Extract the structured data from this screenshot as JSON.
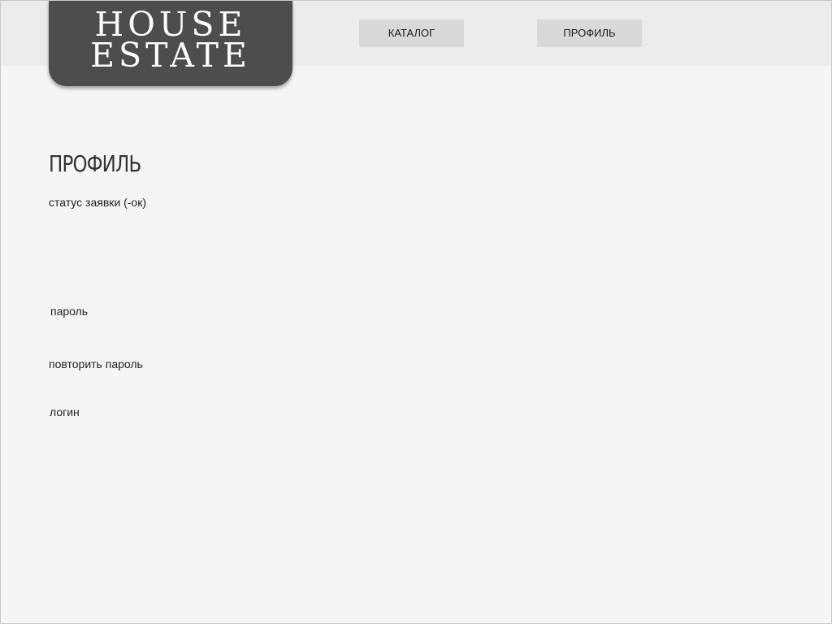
{
  "logo": {
    "line1": "HOUSE",
    "line2": "ESTATE"
  },
  "nav": {
    "catalog_label": "КАТАЛОГ",
    "profile_label": "ПРОФИЛЬ"
  },
  "main": {
    "title": "ПРОФИЛЬ",
    "status_label": "статус заявки (-ок)",
    "password_label": "пароль",
    "repeat_password_label": "повторить пароль",
    "login_label": "логин"
  },
  "colors": {
    "page_background": "#f5f5f5",
    "header_background": "#ececec",
    "logo_background": "#4d4d4d",
    "button_background": "#d9d9d9"
  }
}
